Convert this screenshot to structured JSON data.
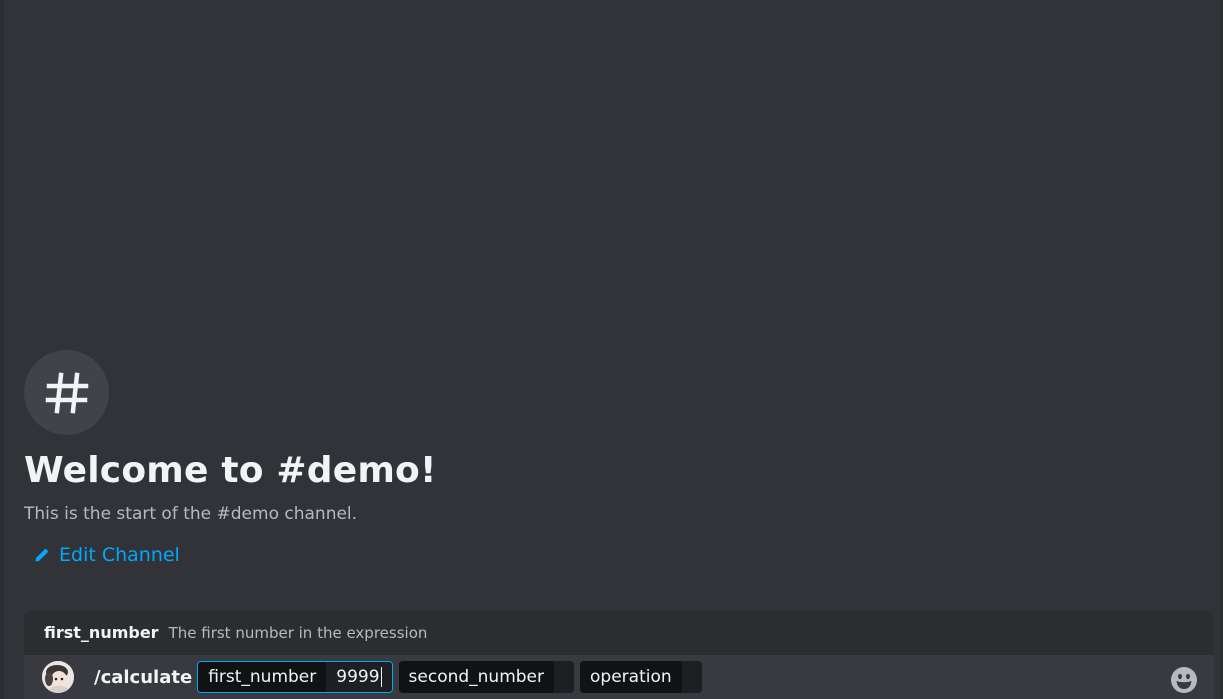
{
  "welcome": {
    "icon": "hash-icon",
    "title": "Welcome to #demo!",
    "subtitle": "This is the start of the #demo channel.",
    "edit_label": "Edit Channel"
  },
  "hint": {
    "option_name": "first_number",
    "option_description": "The first number in the expression"
  },
  "composer": {
    "command": "/calculate",
    "options": [
      {
        "label": "first_number",
        "value": "9999",
        "active": true
      },
      {
        "label": "second_number",
        "value": "",
        "active": false
      },
      {
        "label": "operation",
        "value": "",
        "active": false
      }
    ],
    "emoji_icon": "emoji-icon"
  },
  "colors": {
    "background": "#313338",
    "link": "#00a8fc",
    "composer": "#383a40",
    "hint_bar": "#2b2d31"
  }
}
